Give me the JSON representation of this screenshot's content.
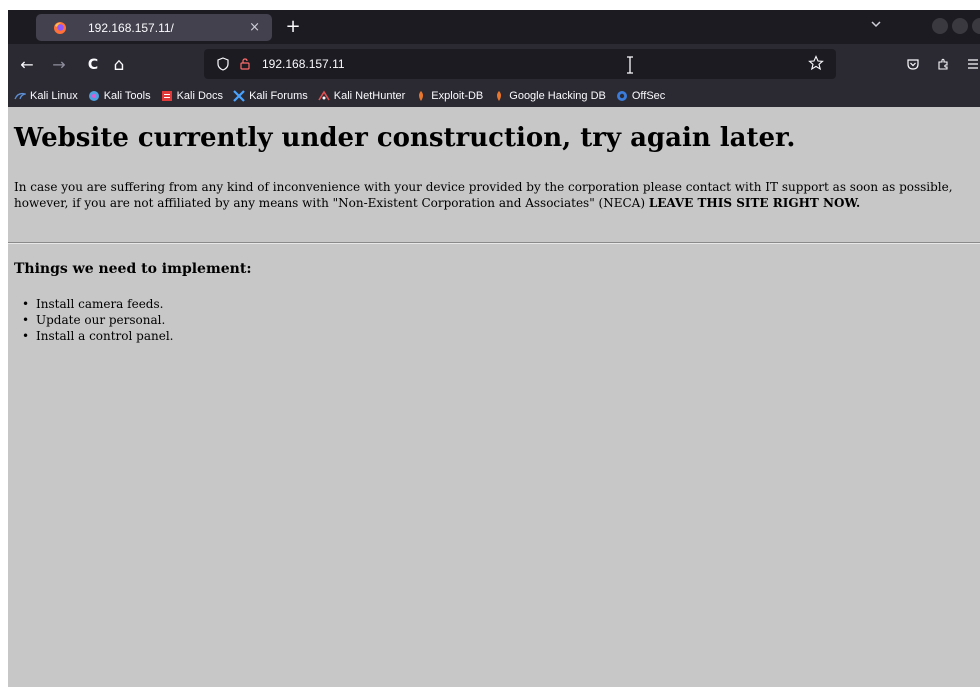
{
  "tab": {
    "title": "192.168.157.11/",
    "close_glyph": "×",
    "new_tab_glyph": "+"
  },
  "nav": {
    "back_glyph": "←",
    "forward_glyph": "→",
    "reload_glyph": "C",
    "home_glyph": "⌂"
  },
  "url": {
    "value": "192.168.157.11"
  },
  "bookmarks": [
    {
      "label": "Kali Linux",
      "icon": "kali-dragon-icon",
      "color": "#5c8fd6"
    },
    {
      "label": "Kali Tools",
      "icon": "kali-tools-icon",
      "color": "#4e9fe0"
    },
    {
      "label": "Kali Docs",
      "icon": "kali-docs-icon",
      "color": "#e03a3a"
    },
    {
      "label": "Kali Forums",
      "icon": "kali-forums-icon",
      "color": "#4aa3ff"
    },
    {
      "label": "Kali NetHunter",
      "icon": "nethunter-icon",
      "color": "#e05050"
    },
    {
      "label": "Exploit-DB",
      "icon": "exploit-db-icon",
      "color": "#e8762c"
    },
    {
      "label": "Google Hacking DB",
      "icon": "ghdb-icon",
      "color": "#e8762c"
    },
    {
      "label": "OffSec",
      "icon": "offsec-icon",
      "color": "#3b7bd9"
    }
  ],
  "page": {
    "heading": "Website currently under construction, try again later.",
    "paragraph": "In case you are suffering from any kind of inconvenience with your device provided by the corporation please contact with IT support as soon as possible, however, if you are not affiliated by any means with \"Non-Existent Corporation and Associates\" (NECA) ",
    "paragraph_bold": "LEAVE THIS SITE RIGHT NOW.",
    "subheading": "Things we need to implement:",
    "list": [
      "Install camera feeds.",
      "Update our personal.",
      "Install a control panel."
    ]
  },
  "colors": {
    "tabbar_bg": "#1c1b22",
    "toolbar_bg": "#2b2a33",
    "page_bg": "#c7c7c7"
  }
}
